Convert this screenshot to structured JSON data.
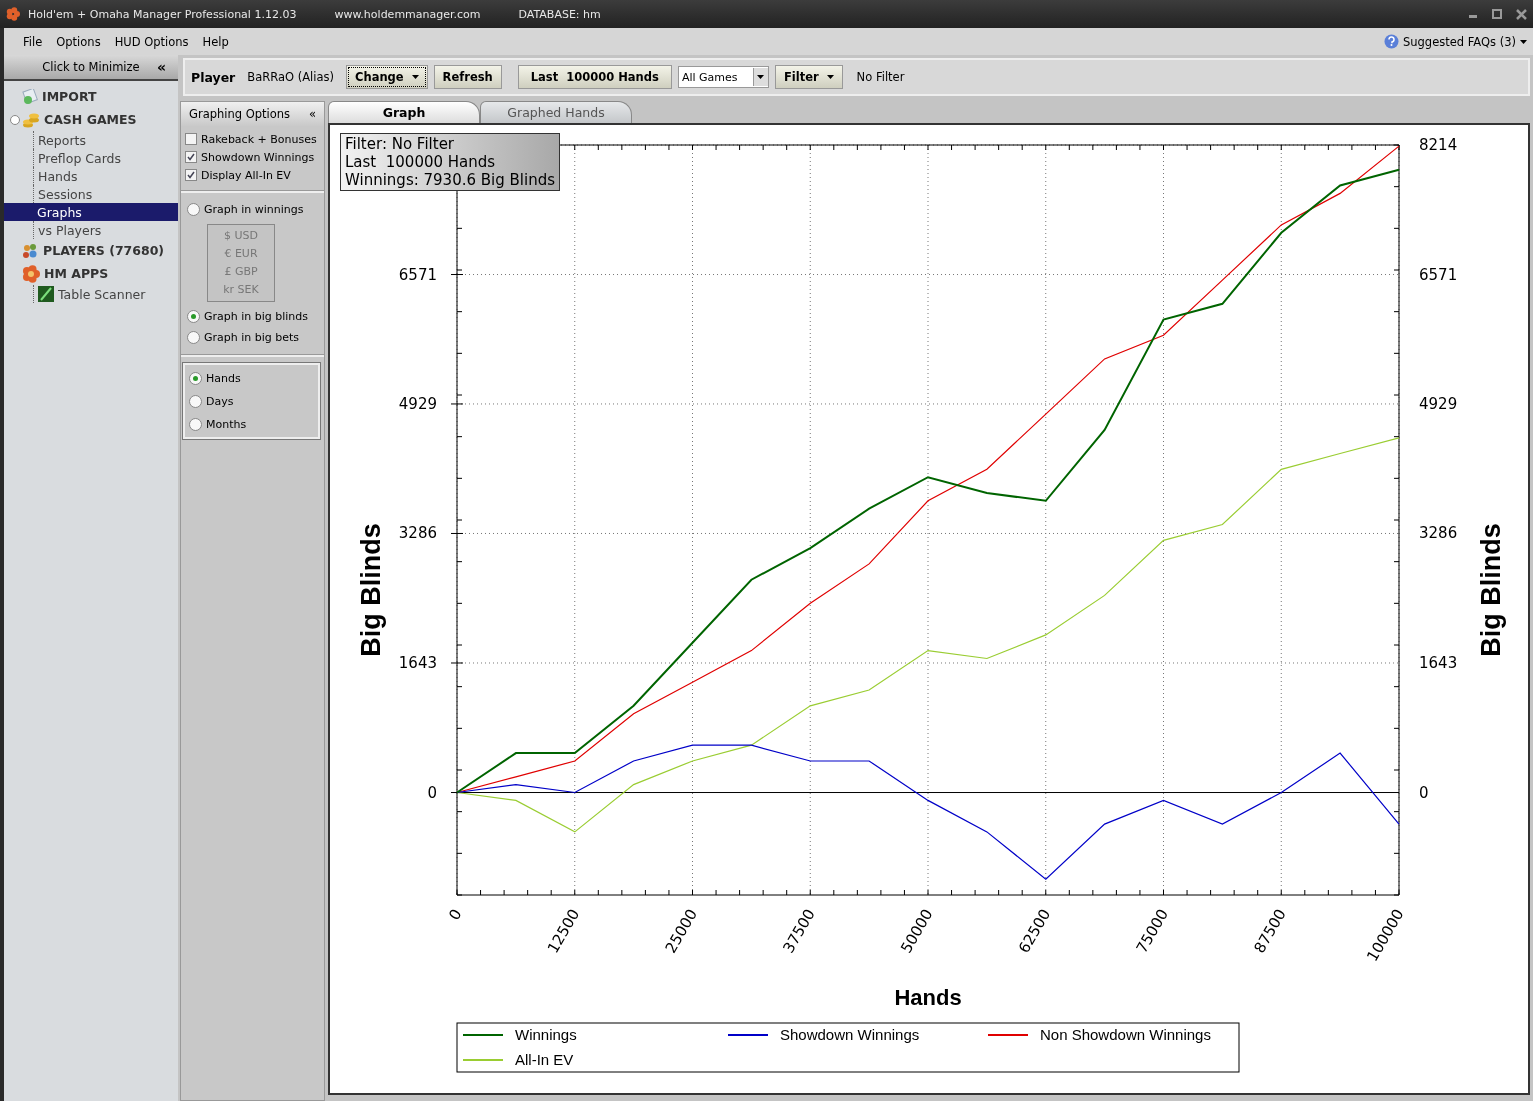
{
  "window": {
    "title": "Hold'em + Omaha Manager Professional 1.12.03",
    "website": "www.holdemmanager.com",
    "database": "DATABASE: hm"
  },
  "menu": [
    "File",
    "Options",
    "HUD Options",
    "Help"
  ],
  "faq": "Suggested FAQs (3)",
  "sidebar": {
    "minimize": "Click to Minimize",
    "minimize_icon": "«",
    "items": [
      {
        "label": "IMPORT",
        "kind": "import"
      },
      {
        "label": "CASH GAMES",
        "kind": "cash",
        "children": [
          {
            "label": "Reports",
            "selected": false
          },
          {
            "label": "Preflop Cards",
            "selected": false
          },
          {
            "label": "Hands",
            "selected": false
          },
          {
            "label": "Sessions",
            "selected": false
          },
          {
            "label": "Graphs",
            "selected": true
          },
          {
            "label": "vs Players",
            "selected": false
          }
        ]
      },
      {
        "label": "PLAYERS (77680)",
        "kind": "players"
      },
      {
        "label": "HM APPS",
        "kind": "apps",
        "children": [
          {
            "label": "Table Scanner",
            "selected": false
          }
        ]
      }
    ]
  },
  "toolbar": {
    "player_label": "Player",
    "player": "BaRRaO (Alias)",
    "change": "Change",
    "refresh": "Refresh",
    "range": "Last  100000 Hands",
    "games": "All Games",
    "filter": "Filter",
    "filter_text": "No Filter"
  },
  "options": {
    "title": "Graphing Options",
    "collapse_icon": "«",
    "checkboxes": [
      {
        "label": "Rakeback + Bonuses",
        "checked": false
      },
      {
        "label": "Showdown Winnings",
        "checked": true
      },
      {
        "label": "Display All-In EV",
        "checked": true
      }
    ],
    "units": [
      {
        "label": "Graph in winnings",
        "selected": false
      },
      {
        "label": "Graph in big blinds",
        "selected": true
      },
      {
        "label": "Graph in big bets",
        "selected": false
      }
    ],
    "currencies": [
      "$ USD",
      "€ EUR",
      "£ GBP",
      "kr SEK"
    ],
    "periods": [
      {
        "label": "Hands",
        "selected": true
      },
      {
        "label": "Days",
        "selected": false
      },
      {
        "label": "Months",
        "selected": false
      }
    ]
  },
  "tabs": [
    {
      "label": "Graph",
      "selected": true
    },
    {
      "label": "Graphed Hands",
      "selected": false
    }
  ],
  "info": [
    "Filter: No Filter",
    "Last  100000 Hands",
    "Winnings: 7930.6 Big Blinds"
  ],
  "right_axis": {
    "title": "Big Blinds",
    "labels": [
      "8214",
      "6571",
      "4929",
      "3286",
      "1643",
      "0"
    ]
  },
  "chart_data": {
    "type": "line",
    "xlabel": "Hands",
    "ylabel": "Big Blinds",
    "grid": true,
    "legend": "bottom",
    "x": [
      0,
      6250,
      12500,
      18750,
      25000,
      31250,
      37500,
      43750,
      50000,
      56250,
      62500,
      68750,
      75000,
      81250,
      87500,
      93750,
      100000
    ],
    "xlim": [
      0,
      100000
    ],
    "ylim": [
      -1300,
      8214
    ],
    "xticks": [
      0,
      12500,
      25000,
      37500,
      50000,
      62500,
      75000,
      87500,
      100000
    ],
    "yticks": [
      {
        "value": 0,
        "label": "0"
      },
      {
        "value": 1643,
        "label": "1643"
      },
      {
        "value": 3286,
        "label": "3286"
      },
      {
        "value": 4929,
        "label": "4929"
      },
      {
        "value": 6571,
        "label": "6571"
      },
      {
        "value": 8214
      }
    ],
    "series": [
      {
        "name": "Winnings",
        "color": "#006400",
        "values": [
          0,
          500,
          500,
          1100,
          1900,
          2700,
          3100,
          3600,
          4000,
          3800,
          3700,
          4600,
          6000,
          6200,
          7100,
          7700,
          7900
        ]
      },
      {
        "name": "Showdown Winnings",
        "color": "#0000c8",
        "values": [
          0,
          100,
          0,
          400,
          600,
          600,
          400,
          400,
          -100,
          -500,
          -1100,
          -400,
          -100,
          -400,
          0,
          500,
          -400
        ]
      },
      {
        "name": "Non Showdown Winnings",
        "color": "#e00000",
        "values": [
          0,
          200,
          400,
          1000,
          1400,
          1800,
          2400,
          2900,
          3700,
          4100,
          4800,
          5500,
          5800,
          6500,
          7200,
          7600,
          8200
        ]
      },
      {
        "name": "All-In EV",
        "color": "#9acd32",
        "values": [
          0,
          -100,
          -500,
          100,
          400,
          600,
          1100,
          1300,
          1800,
          1700,
          2000,
          2500,
          3200,
          3400,
          4100,
          4300,
          4500
        ]
      }
    ]
  }
}
